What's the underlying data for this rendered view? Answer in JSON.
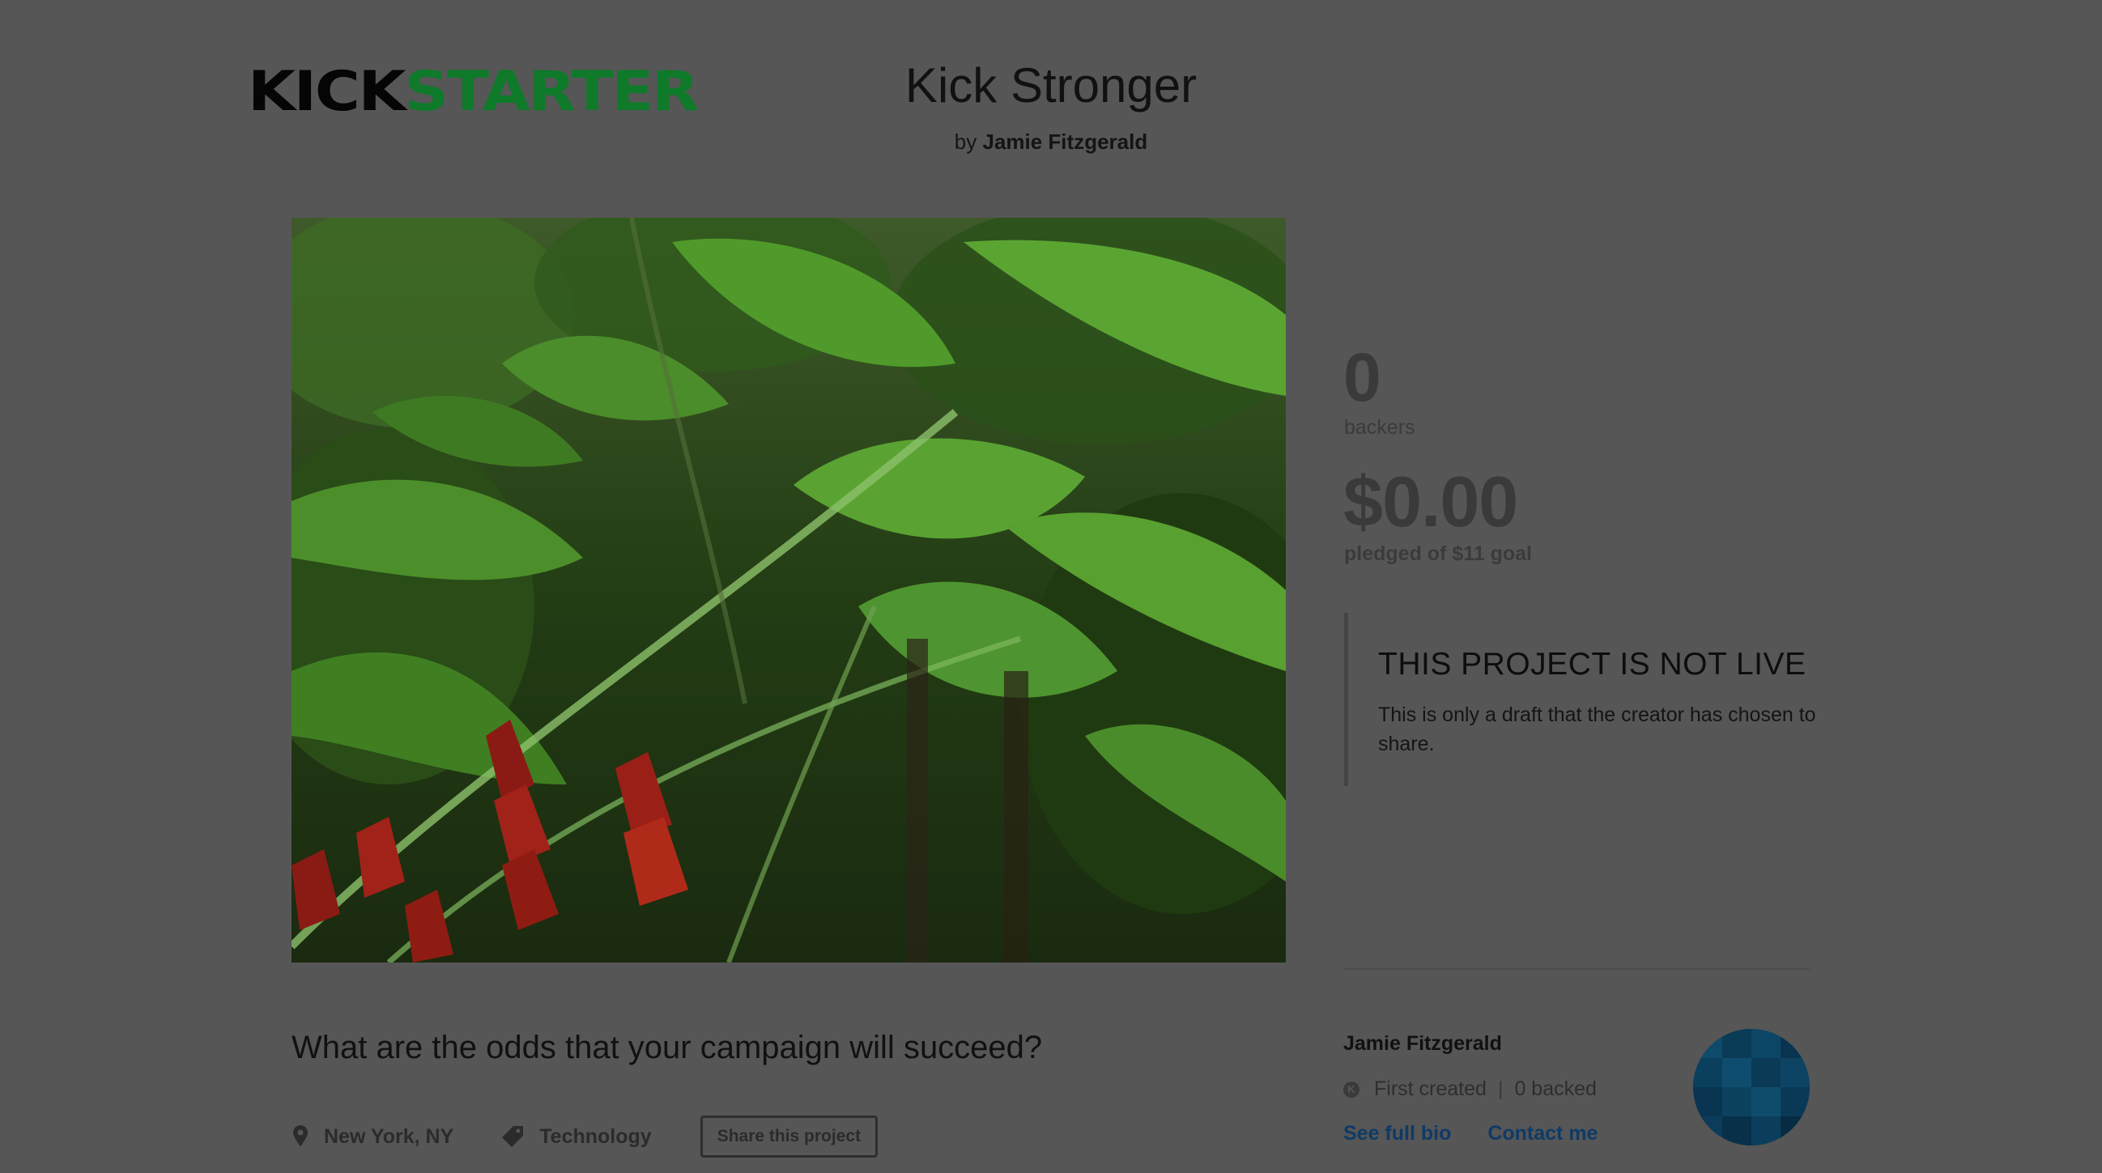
{
  "header": {
    "logo_part1": "KICK",
    "logo_part2": "STARTER",
    "title": "Kick Stronger",
    "by_prefix": "by",
    "creator": "Jamie Fitzgerald"
  },
  "stats": {
    "backers_count": "0",
    "backers_label": "backers",
    "pledged_amount": "$0.00",
    "pledged_label": "pledged of $11 goal"
  },
  "status": {
    "title": "THIS PROJECT IS NOT LIVE",
    "text": "This is only a draft that the creator has chosen to share."
  },
  "creator_card": {
    "name": "Jamie Fitzgerald",
    "first_created": "First created",
    "separator": "|",
    "backed": "0 backed",
    "see_bio": "See full bio",
    "contact": "Contact me"
  },
  "project": {
    "question": "What are the odds that your campaign will succeed?",
    "location": "New York, NY",
    "category": "Technology",
    "share_label": "Share this project"
  },
  "colors": {
    "overlay_background": "#565656",
    "brand_green": "#0e7a2a",
    "link_blue": "#0f3a66"
  }
}
